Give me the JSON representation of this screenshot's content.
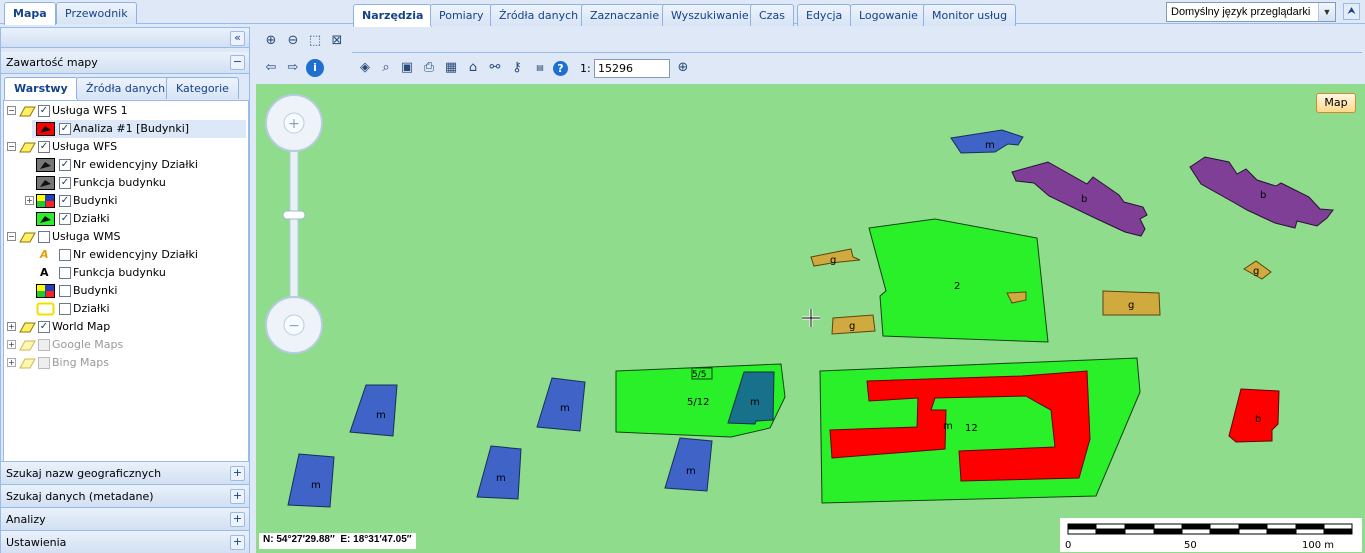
{
  "top_tabs": [
    {
      "label": "Mapa"
    },
    {
      "label": "Przewodnik"
    }
  ],
  "language_select": {
    "value": "Domyślny język przeglądarki"
  },
  "left": {
    "title": "Zawartość mapy",
    "tabs": [
      {
        "label": "Warstwy"
      },
      {
        "label": "Źródła danych"
      },
      {
        "label": "Kategorie"
      }
    ],
    "tree": [
      {
        "label": "Usługa WFS 1",
        "level": 0,
        "checked": true
      },
      {
        "label": "Analiza #1 [Budynki]",
        "level": 1,
        "checked": true,
        "selected": true
      },
      {
        "label": "Usługa WFS",
        "level": 0,
        "checked": true
      },
      {
        "label": "Nr ewidencyjny Działki",
        "level": 1,
        "checked": true
      },
      {
        "label": "Funkcja budynku",
        "level": 1,
        "checked": true
      },
      {
        "label": "Budynki",
        "level": 1,
        "checked": true
      },
      {
        "label": "Działki",
        "level": 1,
        "checked": true
      },
      {
        "label": "Usługa WMS",
        "level": 0,
        "checked": false
      },
      {
        "label": "Nr ewidencyjny Działki",
        "level": 1,
        "checked": false
      },
      {
        "label": "Funkcja budynku",
        "level": 1,
        "checked": false
      },
      {
        "label": "Budynki",
        "level": 1,
        "checked": false
      },
      {
        "label": "Działki",
        "level": 1,
        "checked": false
      },
      {
        "label": "World Map",
        "level": 0,
        "checked": true
      },
      {
        "label": "Google Maps",
        "level": 0,
        "checked": false,
        "disabled": true
      },
      {
        "label": "Bing Maps",
        "level": 0,
        "checked": false,
        "disabled": true
      }
    ],
    "bottom_panels": [
      {
        "label": "Szukaj nazw geograficznych"
      },
      {
        "label": "Szukaj danych (metadane)"
      },
      {
        "label": "Analizy"
      },
      {
        "label": "Ustawienia"
      }
    ]
  },
  "map_tabs": [
    {
      "label": "Narzędzia"
    },
    {
      "label": "Pomiary"
    },
    {
      "label": "Źródła danych"
    },
    {
      "label": "Zaznaczanie"
    },
    {
      "label": "Wyszukiwanie"
    },
    {
      "label": "Czas"
    },
    {
      "label": "Edycja"
    },
    {
      "label": "Logowanie"
    },
    {
      "label": "Monitor usług"
    }
  ],
  "scale": {
    "prefix": "1:",
    "value": "15296"
  },
  "map_button": "Map",
  "coords": {
    "n": "N: 54°27′29.88″",
    "e": "E: 18°31′47.05″"
  },
  "scalebar": {
    "labels": [
      "0",
      "50",
      "100 m"
    ]
  },
  "map_labels": {
    "m": "m",
    "b": "b",
    "g": "g",
    "p2": "2",
    "p12": "12",
    "p512": "5/12",
    "p55": "5/5"
  },
  "colors": {
    "map_bg": "#8fdc8c",
    "parcel": "#2af02a",
    "building_red": "#ff0000",
    "building_blue": "#3f63c6",
    "building_purple": "#7f3f97",
    "building_gold": "#d0aa3e",
    "building_teal": "#17718a"
  }
}
